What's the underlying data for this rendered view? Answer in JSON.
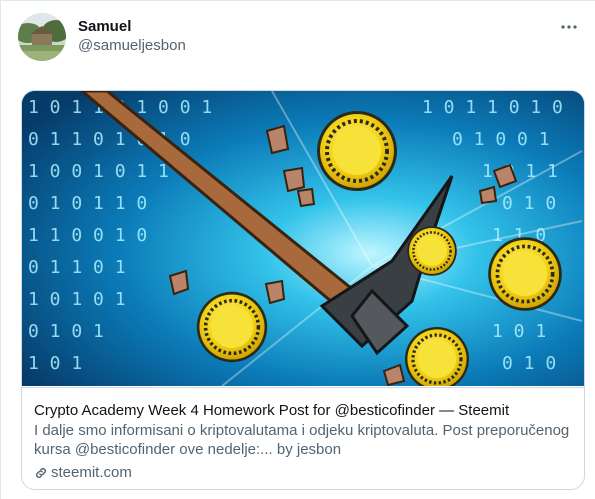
{
  "tweet": {
    "author": {
      "display_name": "Samuel",
      "handle": "@samueljesbon"
    },
    "more_icon": "more-horizontal-icon",
    "card": {
      "image_subject": "pickaxe-mining-crypto-coins",
      "title": "Crypto Academy Week 4 Homework Post for @besticofinder — Steemit",
      "description": "I dalje smo informisani o kriptovalutama i odjeku kriptovaluta. Post preporučenog kursa @besticofinder ove nedelje:... by jesbon",
      "domain": "steemit.com",
      "domain_icon": "link-icon"
    }
  },
  "colors": {
    "text_primary": "#0f1419",
    "text_secondary": "#536471",
    "border": "#cfd9de",
    "coin_gold": "#f2cf12"
  }
}
